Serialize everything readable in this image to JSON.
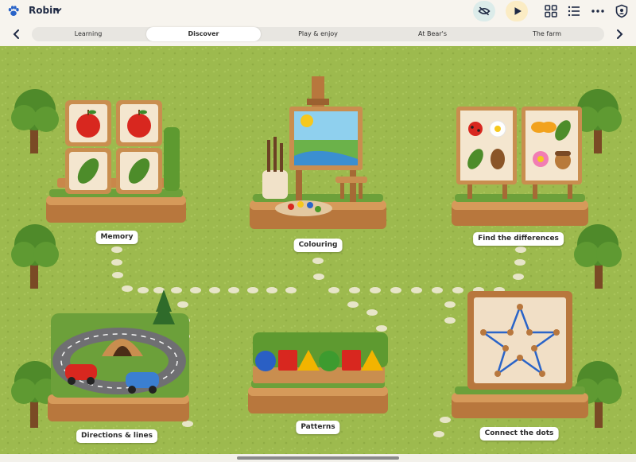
{
  "header": {
    "user_name": "Robin",
    "colors": {
      "accent_blue": "#2a64c8",
      "gold": "#f2b400"
    },
    "icons": [
      "paw-icon",
      "chevron-down-icon",
      "eye-off-icon",
      "play-icon",
      "grid-icon",
      "list-icon",
      "more-icon",
      "shield-icon"
    ]
  },
  "tabs": [
    {
      "label": "Learning"
    },
    {
      "label": "Discover",
      "active": true
    },
    {
      "label": "Play & enjoy"
    },
    {
      "label": "At Bear's"
    },
    {
      "label": "The farm"
    }
  ],
  "activities": [
    {
      "label": "Memory"
    },
    {
      "label": "Colouring"
    },
    {
      "label": "Find the differences"
    },
    {
      "label": "Directions & lines"
    },
    {
      "label": "Patterns"
    },
    {
      "label": "Connect the dots"
    }
  ],
  "colors": {
    "grass": "#97b548",
    "grass_light": "#a9c55a",
    "wood": "#c98e4f",
    "path": "#efe9d3"
  }
}
